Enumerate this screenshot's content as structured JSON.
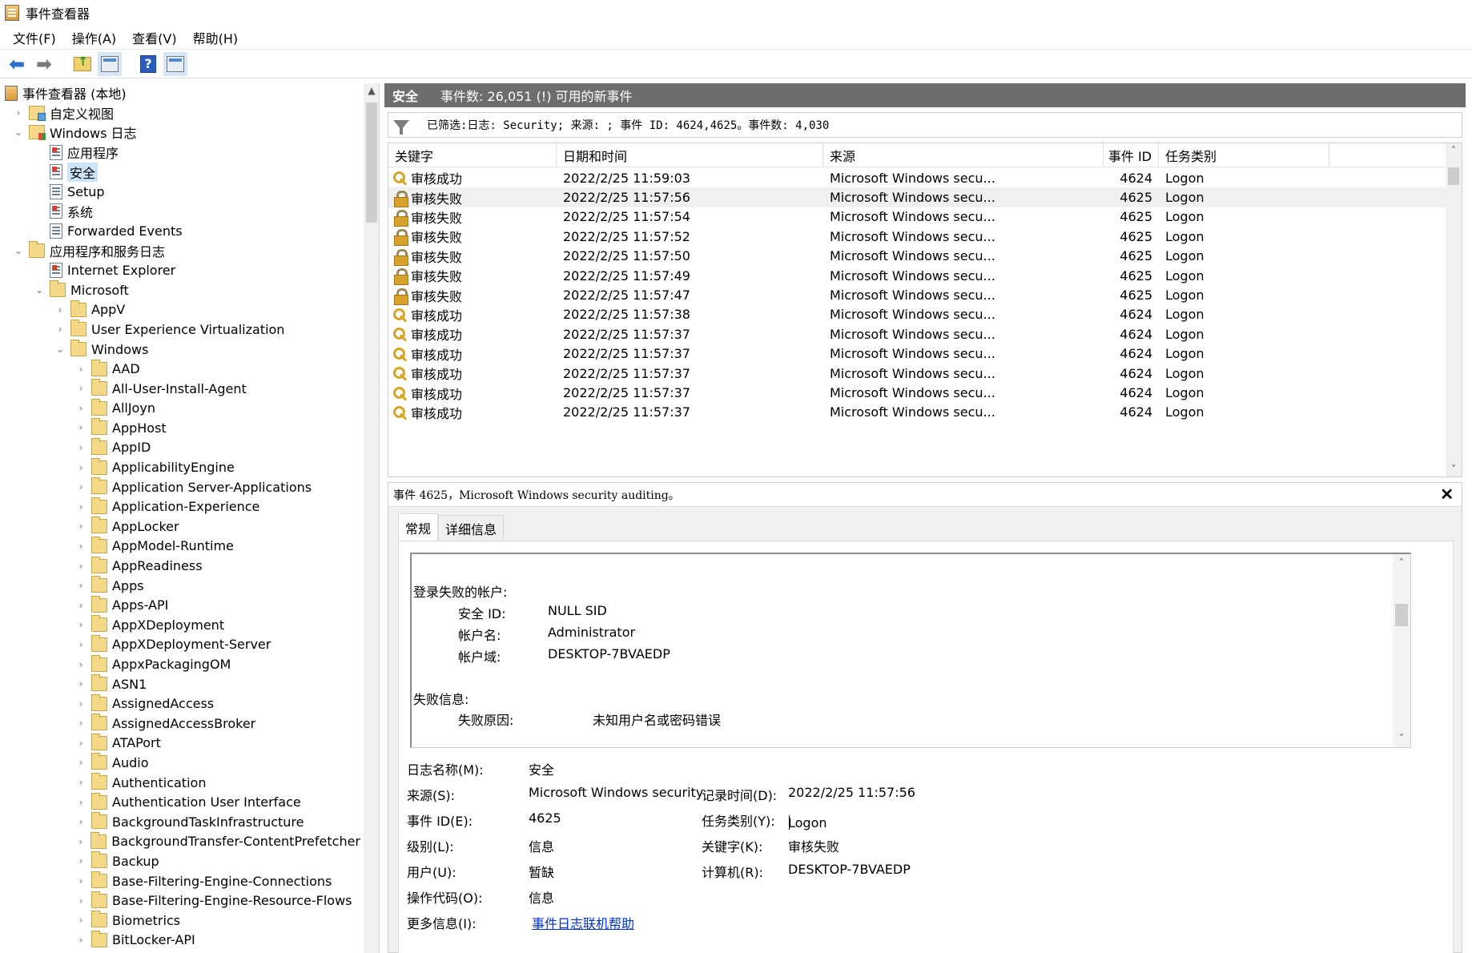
{
  "window": {
    "title": "事件查看器"
  },
  "menu": [
    "文件(F)",
    "操作(A)",
    "查看(V)",
    "帮助(H)"
  ],
  "toolbar": {
    "icons": [
      "back-arrow-icon",
      "forward-arrow-icon",
      "folder-up-icon",
      "show-hide-tree-icon",
      "help-icon",
      "properties-icon"
    ]
  },
  "tree": {
    "items": [
      {
        "label": "事件查看器 (本地)",
        "indent": 0,
        "chev": "",
        "icon": "root"
      },
      {
        "label": "自定义视图",
        "indent": 1,
        "chev": "›",
        "icon": "custom"
      },
      {
        "label": "Windows 日志",
        "indent": 1,
        "chev": "⌄",
        "icon": "winlog"
      },
      {
        "label": "应用程序",
        "indent": 2,
        "chev": "",
        "icon": "logc"
      },
      {
        "label": "安全",
        "indent": 2,
        "chev": "",
        "icon": "logc",
        "selected": true
      },
      {
        "label": "Setup",
        "indent": 2,
        "chev": "",
        "icon": "log"
      },
      {
        "label": "系统",
        "indent": 2,
        "chev": "",
        "icon": "logc"
      },
      {
        "label": "Forwarded Events",
        "indent": 2,
        "chev": "",
        "icon": "log"
      },
      {
        "label": "应用程序和服务日志",
        "indent": 1,
        "chev": "⌄",
        "icon": "folder"
      },
      {
        "label": "Internet Explorer",
        "indent": 2,
        "chev": "",
        "icon": "logc"
      },
      {
        "label": "Microsoft",
        "indent": 2,
        "chev": "⌄",
        "icon": "folder"
      },
      {
        "label": "AppV",
        "indent": 3,
        "chev": "›",
        "icon": "folder"
      },
      {
        "label": "User Experience Virtualization",
        "indent": 3,
        "chev": "›",
        "icon": "folder"
      },
      {
        "label": "Windows",
        "indent": 3,
        "chev": "⌄",
        "icon": "folder"
      },
      {
        "label": "AAD",
        "indent": 4,
        "chev": "›",
        "icon": "folder"
      },
      {
        "label": "All-User-Install-Agent",
        "indent": 4,
        "chev": "›",
        "icon": "folder"
      },
      {
        "label": "AllJoyn",
        "indent": 4,
        "chev": "›",
        "icon": "folder"
      },
      {
        "label": "AppHost",
        "indent": 4,
        "chev": "›",
        "icon": "folder"
      },
      {
        "label": "AppID",
        "indent": 4,
        "chev": "›",
        "icon": "folder"
      },
      {
        "label": "ApplicabilityEngine",
        "indent": 4,
        "chev": "›",
        "icon": "folder"
      },
      {
        "label": "Application Server-Applications",
        "indent": 4,
        "chev": "›",
        "icon": "folder"
      },
      {
        "label": "Application-Experience",
        "indent": 4,
        "chev": "›",
        "icon": "folder"
      },
      {
        "label": "AppLocker",
        "indent": 4,
        "chev": "›",
        "icon": "folder"
      },
      {
        "label": "AppModel-Runtime",
        "indent": 4,
        "chev": "›",
        "icon": "folder"
      },
      {
        "label": "AppReadiness",
        "indent": 4,
        "chev": "›",
        "icon": "folder"
      },
      {
        "label": "Apps",
        "indent": 4,
        "chev": "›",
        "icon": "folder"
      },
      {
        "label": "Apps-API",
        "indent": 4,
        "chev": "›",
        "icon": "folder"
      },
      {
        "label": "AppXDeployment",
        "indent": 4,
        "chev": "›",
        "icon": "folder"
      },
      {
        "label": "AppXDeployment-Server",
        "indent": 4,
        "chev": "›",
        "icon": "folder"
      },
      {
        "label": "AppxPackagingOM",
        "indent": 4,
        "chev": "›",
        "icon": "folder"
      },
      {
        "label": "ASN1",
        "indent": 4,
        "chev": "›",
        "icon": "folder"
      },
      {
        "label": "AssignedAccess",
        "indent": 4,
        "chev": "›",
        "icon": "folder"
      },
      {
        "label": "AssignedAccessBroker",
        "indent": 4,
        "chev": "›",
        "icon": "folder"
      },
      {
        "label": "ATAPort",
        "indent": 4,
        "chev": "›",
        "icon": "folder"
      },
      {
        "label": "Audio",
        "indent": 4,
        "chev": "›",
        "icon": "folder"
      },
      {
        "label": "Authentication",
        "indent": 4,
        "chev": "›",
        "icon": "folder"
      },
      {
        "label": "Authentication User Interface",
        "indent": 4,
        "chev": "›",
        "icon": "folder"
      },
      {
        "label": "BackgroundTaskInfrastructure",
        "indent": 4,
        "chev": "›",
        "icon": "folder"
      },
      {
        "label": "BackgroundTransfer-ContentPrefetcher",
        "indent": 4,
        "chev": "›",
        "icon": "folder"
      },
      {
        "label": "Backup",
        "indent": 4,
        "chev": "›",
        "icon": "folder"
      },
      {
        "label": "Base-Filtering-Engine-Connections",
        "indent": 4,
        "chev": "›",
        "icon": "folder"
      },
      {
        "label": "Base-Filtering-Engine-Resource-Flows",
        "indent": 4,
        "chev": "›",
        "icon": "folder"
      },
      {
        "label": "Biometrics",
        "indent": 4,
        "chev": "›",
        "icon": "folder"
      },
      {
        "label": "BitLocker-API",
        "indent": 4,
        "chev": "›",
        "icon": "folder"
      }
    ]
  },
  "header": {
    "name": "安全",
    "count": "事件数: 26,051 (!) 可用的新事件"
  },
  "filter": {
    "text": "已筛选:日志: Security; 来源: ; 事件 ID: 4624,4625。事件数: 4,030"
  },
  "grid": {
    "columns": [
      "关键字",
      "日期和时间",
      "来源",
      "事件 ID",
      "任务类别"
    ],
    "rows": [
      {
        "kw": "审核成功",
        "icon": "key",
        "date": "2022/2/25 11:59:03",
        "src": "Microsoft Windows secu...",
        "id": "4624",
        "task": "Logon"
      },
      {
        "kw": "审核失败",
        "icon": "lock",
        "date": "2022/2/25 11:57:56",
        "src": "Microsoft Windows secu...",
        "id": "4625",
        "task": "Logon",
        "selected": true
      },
      {
        "kw": "审核失败",
        "icon": "lock",
        "date": "2022/2/25 11:57:54",
        "src": "Microsoft Windows secu...",
        "id": "4625",
        "task": "Logon"
      },
      {
        "kw": "审核失败",
        "icon": "lock",
        "date": "2022/2/25 11:57:52",
        "src": "Microsoft Windows secu...",
        "id": "4625",
        "task": "Logon"
      },
      {
        "kw": "审核失败",
        "icon": "lock",
        "date": "2022/2/25 11:57:50",
        "src": "Microsoft Windows secu...",
        "id": "4625",
        "task": "Logon"
      },
      {
        "kw": "审核失败",
        "icon": "lock",
        "date": "2022/2/25 11:57:49",
        "src": "Microsoft Windows secu...",
        "id": "4625",
        "task": "Logon"
      },
      {
        "kw": "审核失败",
        "icon": "lock",
        "date": "2022/2/25 11:57:47",
        "src": "Microsoft Windows secu...",
        "id": "4625",
        "task": "Logon"
      },
      {
        "kw": "审核成功",
        "icon": "key",
        "date": "2022/2/25 11:57:38",
        "src": "Microsoft Windows secu...",
        "id": "4624",
        "task": "Logon"
      },
      {
        "kw": "审核成功",
        "icon": "key",
        "date": "2022/2/25 11:57:37",
        "src": "Microsoft Windows secu...",
        "id": "4624",
        "task": "Logon"
      },
      {
        "kw": "审核成功",
        "icon": "key",
        "date": "2022/2/25 11:57:37",
        "src": "Microsoft Windows secu...",
        "id": "4624",
        "task": "Logon"
      },
      {
        "kw": "审核成功",
        "icon": "key",
        "date": "2022/2/25 11:57:37",
        "src": "Microsoft Windows secu...",
        "id": "4624",
        "task": "Logon"
      },
      {
        "kw": "审核成功",
        "icon": "key",
        "date": "2022/2/25 11:57:37",
        "src": "Microsoft Windows secu...",
        "id": "4624",
        "task": "Logon"
      },
      {
        "kw": "审核成功",
        "icon": "key",
        "date": "2022/2/25 11:57:37",
        "src": "Microsoft Windows secu...",
        "id": "4624",
        "task": "Logon"
      }
    ]
  },
  "detail": {
    "title": "事件 4625，Microsoft Windows security auditing。",
    "tabs": [
      "常规",
      "详细信息"
    ],
    "message": {
      "section1": "登录失败的帐户:",
      "fields": [
        {
          "label": "安全 ID:",
          "value": "NULL SID"
        },
        {
          "label": "帐户名:",
          "value": "Administrator"
        },
        {
          "label": "帐户域:",
          "value": "DESKTOP-7BVAEDP"
        }
      ],
      "section2": "失败信息:",
      "partial_label": "失败原因:",
      "partial_value": "未知用户名或密码错误"
    },
    "props": {
      "log_name_label": "日志名称(M):",
      "log_name": "安全",
      "source_label": "来源(S):",
      "source": "Microsoft Windows security",
      "logged_label": "记录时间(D):",
      "logged": "2022/2/25 11:57:56",
      "event_id_label": "事件 ID(E):",
      "event_id": "4625",
      "task_label": "任务类别(Y):",
      "task": "Logon",
      "level_label": "级别(L):",
      "level": "信息",
      "keywords_label": "关键字(K):",
      "keywords": "审核失败",
      "user_label": "用户(U):",
      "user": "暂缺",
      "computer_label": "计算机(R):",
      "computer": "DESKTOP-7BVAEDP",
      "opcode_label": "操作代码(O):",
      "opcode": "信息",
      "more_label": "更多信息(I):",
      "more_link": "事件日志联机帮助"
    }
  }
}
